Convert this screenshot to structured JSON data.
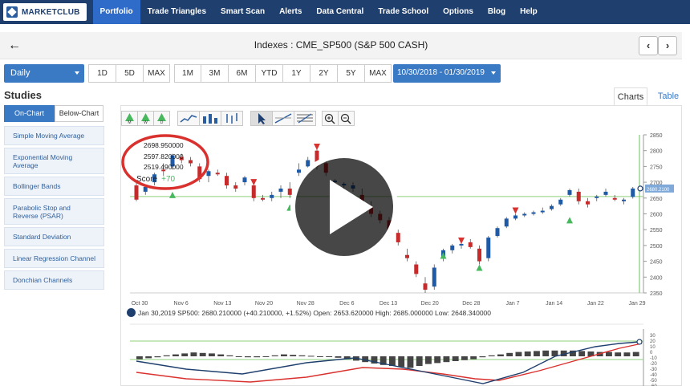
{
  "nav": {
    "logo_text": "MARKETCLUB",
    "items": [
      "Portfolio",
      "Trade Triangles",
      "Smart Scan",
      "Alerts",
      "Data Central",
      "Trade School",
      "Options",
      "Blog",
      "Help"
    ]
  },
  "header": {
    "back_icon": "arrow-left-icon",
    "title": "Indexes : CME_SP500 (S&P 500 CASH)",
    "prev_icon": "chevron-left-icon",
    "next_icon": "chevron-right-icon"
  },
  "toolbar": {
    "interval": "Daily",
    "ranges_a": [
      "1D",
      "5D",
      "MAX"
    ],
    "ranges_b": [
      "1M",
      "3M",
      "6M",
      "YTD",
      "1Y",
      "2Y",
      "5Y",
      "MAX"
    ],
    "date_range": "10/30/2018 - 01/30/2019"
  },
  "view_tabs": {
    "charts": "Charts",
    "table": "Table"
  },
  "studies": {
    "title": "Studies",
    "tab_on": "On-Chart",
    "tab_below": "Below-Chart",
    "items": [
      "Simple Moving Average",
      "Exponential Moving Average",
      "Bollinger Bands",
      "Parabolic Stop and Reverse (PSAR)",
      "Standard Deviation",
      "Linear Regression Channel",
      "Donchian Channels"
    ]
  },
  "chart_tools": {
    "triangle_labels": [
      "M",
      "W",
      "D"
    ]
  },
  "triangles_legend": {
    "values": [
      "2698.950000",
      "2597.820000",
      "2519.490000"
    ],
    "score_label": "Score",
    "score_value": "+70"
  },
  "info_line": "Jan 30,2019 SP500: 2680.210000 (+40.210000, +1.52%) Open: 2653.620000 High: 2685.000000 Low: 2648.340000",
  "chart_data": {
    "type": "candlestick",
    "x_ticks": [
      "Oct 30",
      "Nov 6",
      "Nov 13",
      "Nov 20",
      "Nov 28",
      "Dec 6",
      "Dec 13",
      "Dec 20",
      "Dec 28",
      "Jan 7",
      "Jan 14",
      "Jan 22",
      "Jan 29"
    ],
    "y_ticks": [
      2350,
      2400,
      2450,
      2500,
      2550,
      2600,
      2650,
      2700,
      2750,
      2800,
      2850
    ],
    "ylim": [
      2350,
      2850
    ],
    "last_price_label": "2680.2100",
    "candles": [
      [
        2690,
        2700,
        2640,
        2645
      ],
      [
        2670,
        2690,
        2660,
        2685
      ],
      [
        2700,
        2730,
        2690,
        2725
      ],
      [
        2740,
        2760,
        2720,
        2735
      ],
      [
        2750,
        2790,
        2740,
        2785
      ],
      [
        2780,
        2790,
        2760,
        2770
      ],
      [
        2770,
        2780,
        2750,
        2760
      ],
      [
        2750,
        2760,
        2700,
        2710
      ],
      [
        2720,
        2740,
        2700,
        2735
      ],
      [
        2730,
        2740,
        2720,
        2725
      ],
      [
        2720,
        2730,
        2680,
        2690
      ],
      [
        2690,
        2700,
        2670,
        2680
      ],
      [
        2700,
        2720,
        2690,
        2715
      ],
      [
        2690,
        2700,
        2640,
        2650
      ],
      [
        2650,
        2660,
        2640,
        2645
      ],
      [
        2650,
        2670,
        2640,
        2660
      ],
      [
        2670,
        2690,
        2650,
        2680
      ],
      [
        2680,
        2700,
        2650,
        2660
      ],
      [
        2730,
        2760,
        2720,
        2740
      ],
      [
        2750,
        2780,
        2740,
        2770
      ],
      [
        2800,
        2810,
        2740,
        2750
      ],
      [
        2760,
        2780,
        2720,
        2730
      ],
      [
        2700,
        2710,
        2690,
        2705
      ],
      [
        2690,
        2700,
        2680,
        2695
      ],
      [
        2680,
        2700,
        2670,
        2690
      ],
      [
        2660,
        2680,
        2630,
        2640
      ],
      [
        2620,
        2640,
        2590,
        2600
      ],
      [
        2600,
        2610,
        2570,
        2580
      ],
      [
        2580,
        2590,
        2540,
        2550
      ],
      [
        2540,
        2550,
        2500,
        2510
      ],
      [
        2470,
        2490,
        2450,
        2460
      ],
      [
        2440,
        2450,
        2400,
        2410
      ],
      [
        2380,
        2400,
        2350,
        2360
      ],
      [
        2370,
        2440,
        2360,
        2430
      ],
      [
        2460,
        2490,
        2450,
        2485
      ],
      [
        2485,
        2505,
        2475,
        2500
      ],
      [
        2500,
        2510,
        2490,
        2505
      ],
      [
        2510,
        2520,
        2490,
        2495
      ],
      [
        2490,
        2500,
        2440,
        2450
      ],
      [
        2460,
        2530,
        2450,
        2525
      ],
      [
        2530,
        2560,
        2525,
        2555
      ],
      [
        2560,
        2590,
        2555,
        2585
      ],
      [
        2585,
        2600,
        2580,
        2595
      ],
      [
        2595,
        2605,
        2590,
        2600
      ],
      [
        2600,
        2610,
        2595,
        2605
      ],
      [
        2605,
        2620,
        2600,
        2610
      ],
      [
        2615,
        2630,
        2610,
        2625
      ],
      [
        2630,
        2650,
        2625,
        2645
      ],
      [
        2660,
        2680,
        2655,
        2675
      ],
      [
        2670,
        2680,
        2630,
        2640
      ],
      [
        2640,
        2650,
        2620,
        2630
      ],
      [
        2650,
        2660,
        2640,
        2655
      ],
      [
        2660,
        2680,
        2655,
        2670
      ],
      [
        2650,
        2660,
        2640,
        2645
      ],
      [
        2640,
        2650,
        2630,
        2645
      ],
      [
        2653.62,
        2685,
        2648.34,
        2680.21
      ]
    ]
  }
}
